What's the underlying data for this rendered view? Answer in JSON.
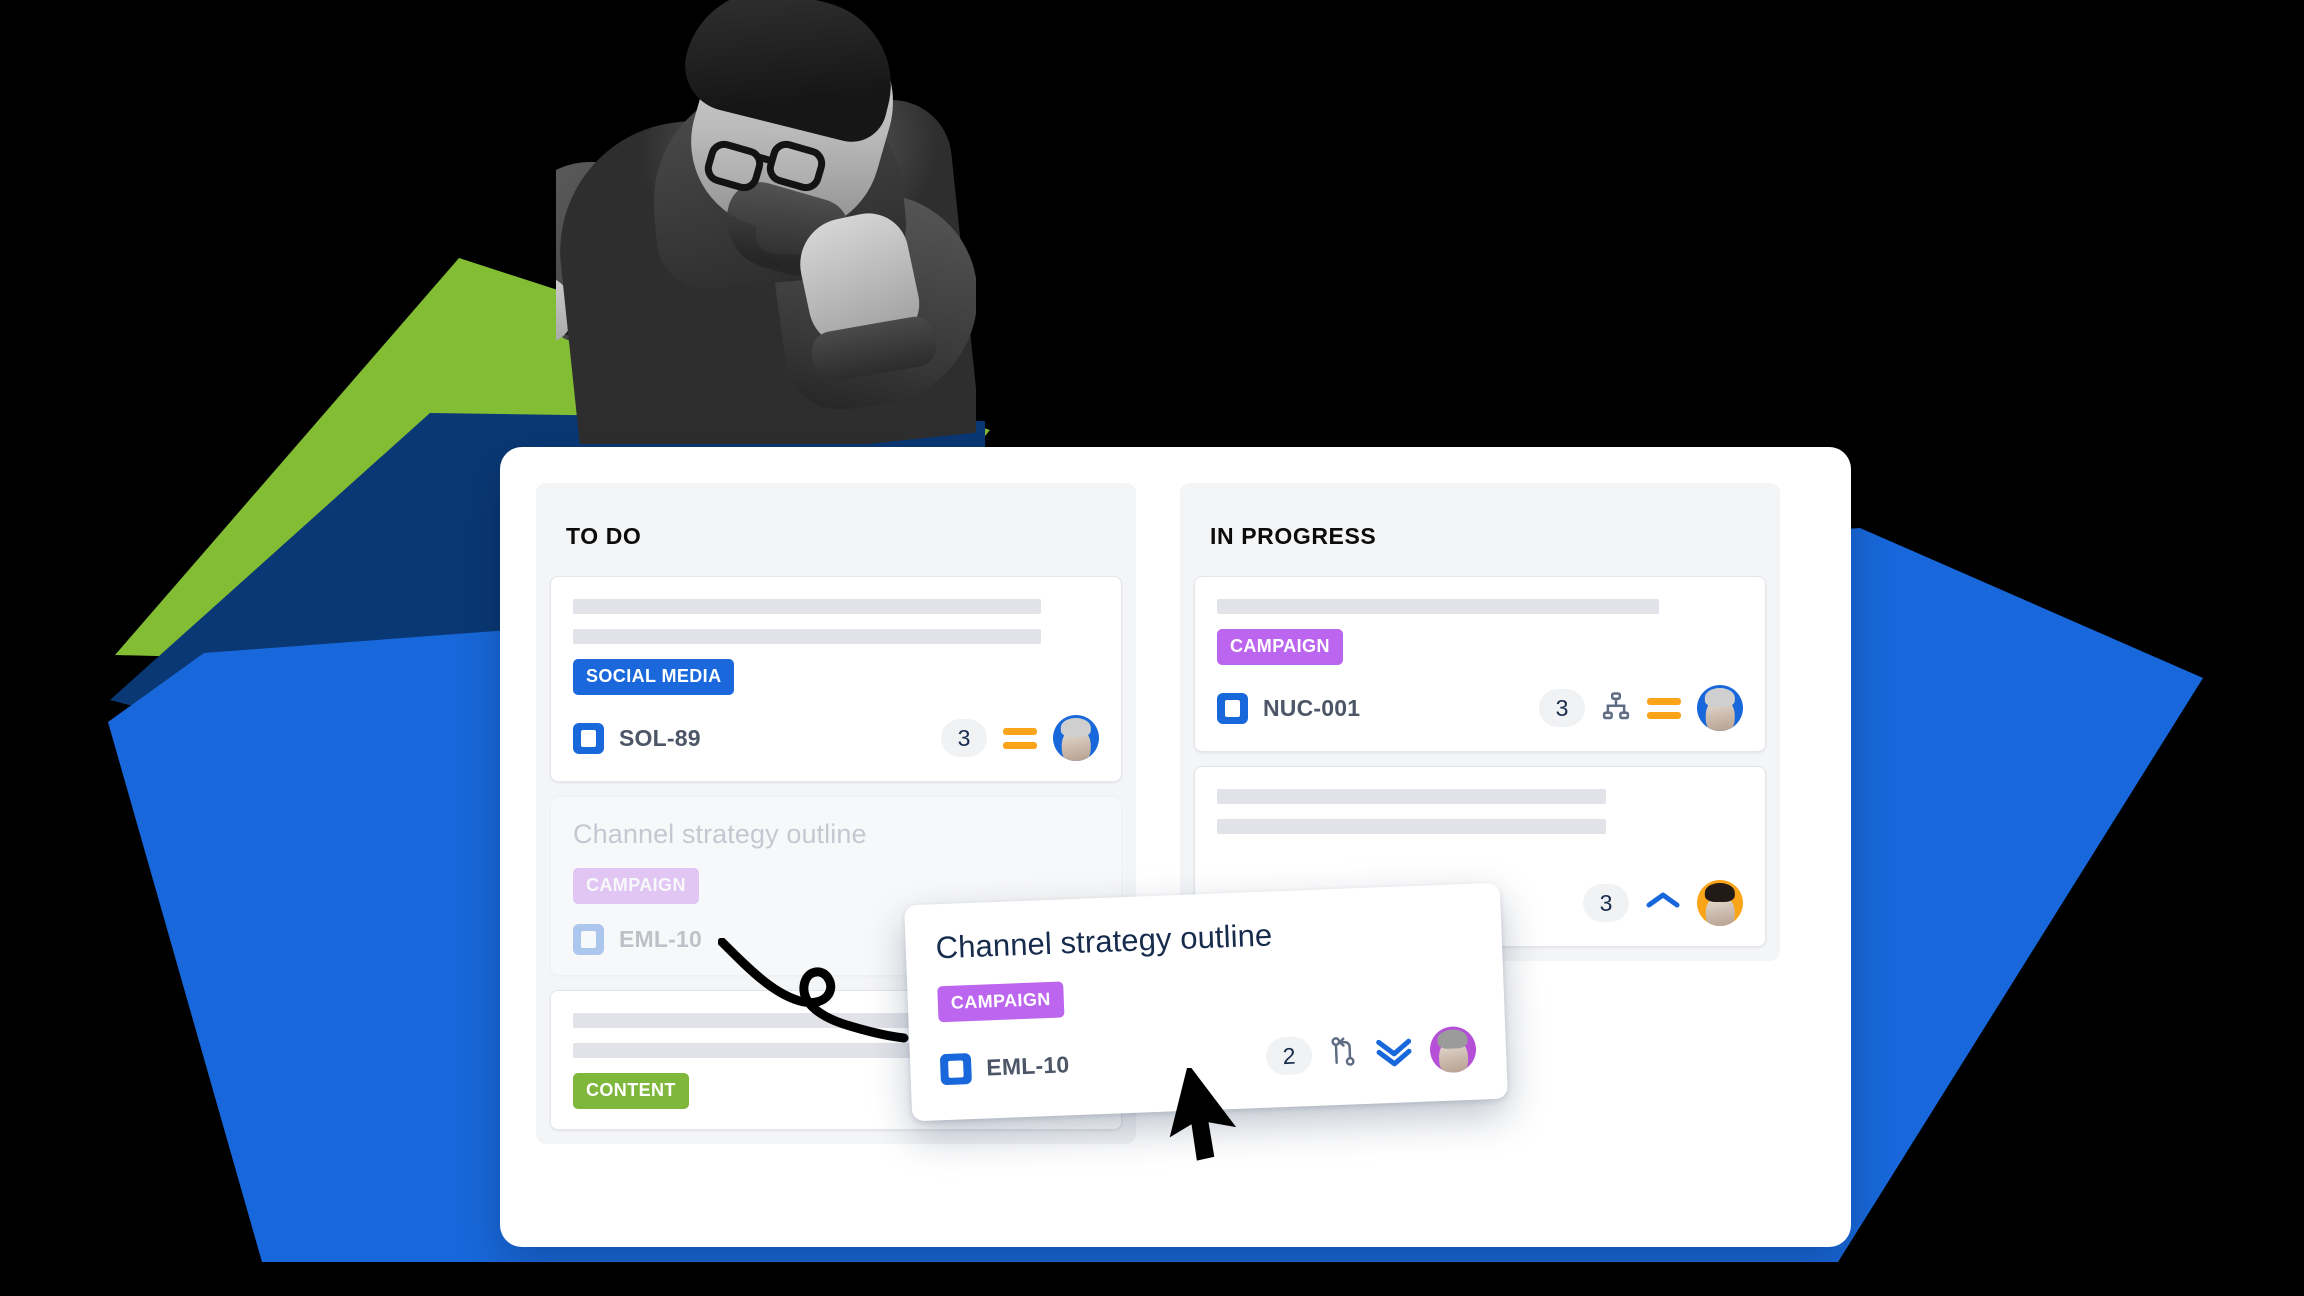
{
  "theme": {
    "bg": "#000000",
    "green": "#83BD33",
    "navy": "#0A3875",
    "blue": "#1868DB",
    "board_bg": "#FFFFFF",
    "column_bg": "#F4F5F7",
    "skeleton": "#E1E3E8",
    "text_dark": "#172B4D",
    "ticket_text": "#4C5667",
    "priority_medium": "#FAA41A",
    "priority_low": "#1868DB"
  },
  "board": {
    "columns": [
      {
        "title": "TO DO",
        "cards": [
          {
            "id": "card-sol-89",
            "skeleton_lines": 2,
            "label": {
              "text": "SOCIAL MEDIA",
              "color": "#1A68DB"
            },
            "ticket": "SOL-89",
            "type_icon": "story-icon",
            "count": "3",
            "priority": "medium",
            "priority_icon": "equals-icon",
            "avatar": {
              "name": "avatar-woman-headwrap",
              "color": "#1868DB"
            },
            "state": "normal"
          },
          {
            "id": "card-eml-10-ghost",
            "title": "Channel strategy outline",
            "label": {
              "text": "CAMPAIGN",
              "color": "#BC66F0"
            },
            "ticket": "EML-10",
            "type_icon": "story-icon",
            "state": "ghost"
          },
          {
            "id": "card-content",
            "skeleton_lines": 2,
            "label": {
              "text": "CONTENT",
              "color": "#7FB63C"
            },
            "state": "normal"
          }
        ]
      },
      {
        "title": "IN PROGRESS",
        "cards": [
          {
            "id": "card-nuc-001",
            "skeleton_lines": 1,
            "label": {
              "text": "CAMPAIGN",
              "color": "#BC66F0"
            },
            "ticket": "NUC-001",
            "type_icon": "story-icon",
            "count": "3",
            "subtask_icon": "hierarchy-icon",
            "priority": "medium",
            "priority_icon": "equals-icon",
            "avatar": {
              "name": "avatar-woman-headwrap",
              "color": "#1868DB"
            },
            "state": "normal"
          },
          {
            "id": "card-second",
            "skeleton_lines": 2,
            "count": "3",
            "priority": "high",
            "priority_icon": "chevron-up-icon",
            "avatar": {
              "name": "avatar-woman-dark-hair",
              "color": "#FAA41A"
            },
            "state": "normal"
          }
        ]
      }
    ]
  },
  "drag_card": {
    "title": "Channel strategy outline",
    "label": {
      "text": "CAMPAIGN",
      "color": "#BC66F0"
    },
    "ticket": "EML-10",
    "type_icon": "story-icon",
    "count": "2",
    "branch_icon": "pull-request-icon",
    "priority": "low",
    "priority_icon": "double-chevron-down-icon",
    "avatar": {
      "name": "avatar-man-grey-hair",
      "color": "#B64FD8"
    }
  },
  "annotations": {
    "squiggle": "hand-drawn-loop-arrow",
    "cursor": "mouse-pointer"
  },
  "photo": {
    "subject": "man-with-glasses-thinking"
  }
}
